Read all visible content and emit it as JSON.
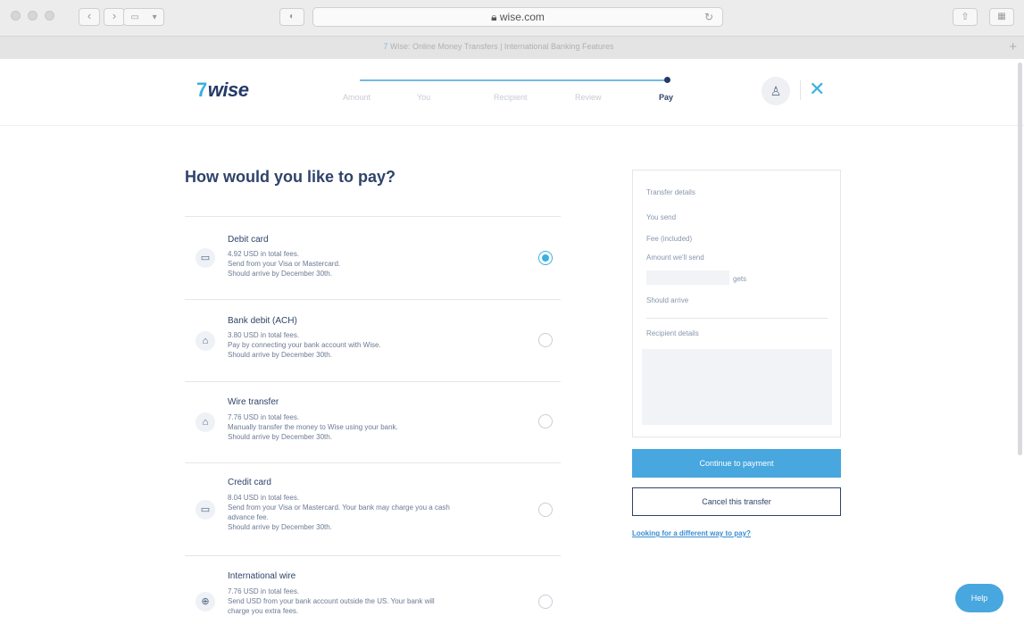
{
  "browser": {
    "url": "wise.com",
    "tab_title": "Wise: Online Money Transfers | International Banking Features",
    "back_glyph": "‹",
    "forward_glyph": "›",
    "new_tab_glyph": "+",
    "reload_glyph": "↻"
  },
  "header": {
    "logo_flag": "7",
    "logo_text": "wise",
    "steps": [
      "Amount",
      "You",
      "Recipient",
      "Review",
      "Pay"
    ],
    "active_step": "Pay",
    "close_glyph": "✕"
  },
  "main": {
    "title": "How would you like to pay?",
    "options": [
      {
        "icon": "card-icon",
        "title": "Debit card",
        "lines": [
          "4.92 USD in total fees.",
          "Send from your Visa or Mastercard.",
          "Should arrive by December 30th."
        ],
        "selected": true
      },
      {
        "icon": "bank-icon",
        "title": "Bank debit (ACH)",
        "lines": [
          "3.80 USD in total fees.",
          "Pay by connecting your bank account with Wise.",
          "Should arrive by December 30th."
        ],
        "selected": false
      },
      {
        "icon": "bank-icon",
        "title": "Wire transfer",
        "lines": [
          "7.76 USD in total fees.",
          "Manually transfer the money to Wise using your bank.",
          "Should arrive by December 30th."
        ],
        "selected": false
      },
      {
        "icon": "card-icon",
        "title": "Credit card",
        "lines": [
          "8.04 USD in total fees.",
          "Send from your Visa or Mastercard. Your bank may charge you a cash",
          "advance fee.",
          "Should arrive by December 30th."
        ],
        "selected": false
      },
      {
        "icon": "globe-icon",
        "title": "International wire",
        "lines": [
          "7.76 USD in total fees.",
          "Send USD from your bank account outside the US. Your bank will",
          "charge you extra fees."
        ],
        "selected": false
      }
    ]
  },
  "summary": {
    "transfer_details": "Transfer details",
    "you_send": "You send",
    "fee": "Fee (included)",
    "amount_we_send": "Amount we'll send",
    "gets": "gets",
    "should_arrive": "Should arrive",
    "recipient_details": "Recipient details"
  },
  "actions": {
    "continue_label": "Continue to payment",
    "cancel_label": "Cancel this transfer",
    "alt_link": "Looking for a different way to pay?",
    "help_label": "Help"
  },
  "colors": {
    "accent": "#47a7de",
    "navy": "#2e4369"
  }
}
